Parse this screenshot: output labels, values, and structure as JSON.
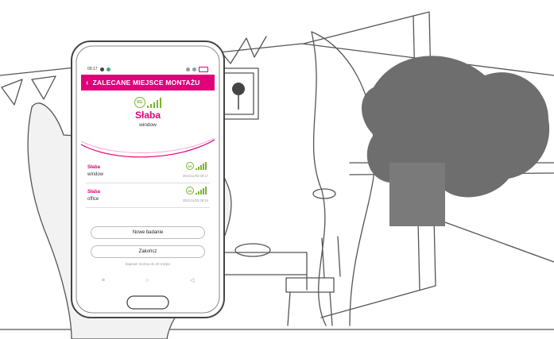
{
  "status_bar": {
    "time": "09:17"
  },
  "app_bar": {
    "back_icon": "chevron-left-icon",
    "title": "ZALECANE MIEJSCE MONTAŻU"
  },
  "recommendation": {
    "network_badge": "5G",
    "signal_bars_filled": 5,
    "quality": "Słaba",
    "location": "window"
  },
  "measurements": [
    {
      "quality": "Słaba",
      "location": "window",
      "network_badge": "5G",
      "timestamp": "2021/11/03 09:17"
    },
    {
      "quality": "Słaba",
      "location": "office",
      "network_badge": "5G",
      "timestamp": "2021/11/03 09:15"
    }
  ],
  "buttons": {
    "new_test": "Nowe badanie",
    "finish": "Zakończ"
  },
  "hint": "Zapisać można do 20 miejsc",
  "nav": {
    "menu_icon": "menu-icon",
    "home_icon": "home-icon",
    "back_icon": "back-triangle-icon"
  },
  "colors": {
    "brand": "#e2007a",
    "signal": "#7ab32e"
  }
}
